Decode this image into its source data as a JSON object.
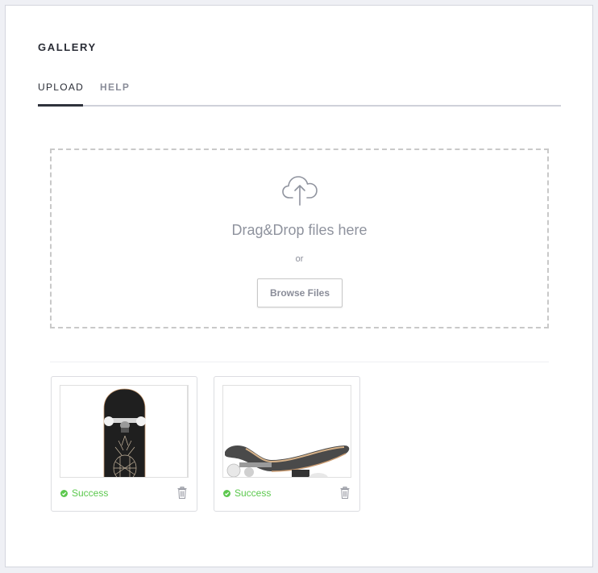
{
  "page": {
    "title": "GALLERY"
  },
  "tabs": [
    {
      "label": "UPLOAD",
      "active": true
    },
    {
      "label": "HELP",
      "active": false
    }
  ],
  "dropzone": {
    "icon": "cloud-upload-icon",
    "main_text": "Drag&Drop files here",
    "or_text": "or",
    "browse_label": "Browse Files"
  },
  "files": [
    {
      "thumbnail": "skateboard-black-pineapple-deck",
      "status": "Success",
      "status_icon": "check-circle-icon",
      "delete_icon": "trash-icon"
    },
    {
      "thumbnail": "skateboard-side-view",
      "status": "Success",
      "status_icon": "check-circle-icon",
      "delete_icon": "trash-icon"
    }
  ],
  "colors": {
    "success": "#5cc84e",
    "active_tab": "#2f323c",
    "muted_text": "#8a8d99",
    "background": "#eff0f5"
  }
}
